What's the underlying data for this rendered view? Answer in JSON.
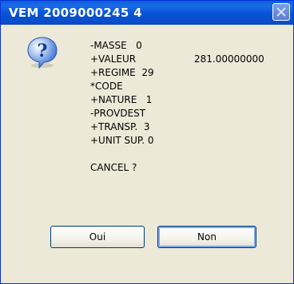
{
  "window": {
    "title": "VEM 2009000245   4"
  },
  "icons": {
    "dialog": "question-icon",
    "close": "close-icon"
  },
  "message": {
    "lines": [
      {
        "label": "-MASSE   0",
        "value": ""
      },
      {
        "label": "+VALEUR",
        "value": "281.00000000"
      },
      {
        "label": "+REGIME  29",
        "value": ""
      },
      {
        "label": "*CODE",
        "value": ""
      },
      {
        "label": "+NATURE   1",
        "value": ""
      },
      {
        "label": "-PROVDEST",
        "value": ""
      },
      {
        "label": "+TRANSP.  3",
        "value": ""
      },
      {
        "label": "+UNIT SUP. 0",
        "value": ""
      },
      {
        "label": "",
        "value": ""
      },
      {
        "label": "CANCEL ?",
        "value": ""
      }
    ]
  },
  "buttons": {
    "yes": "Oui",
    "no": "Non"
  }
}
